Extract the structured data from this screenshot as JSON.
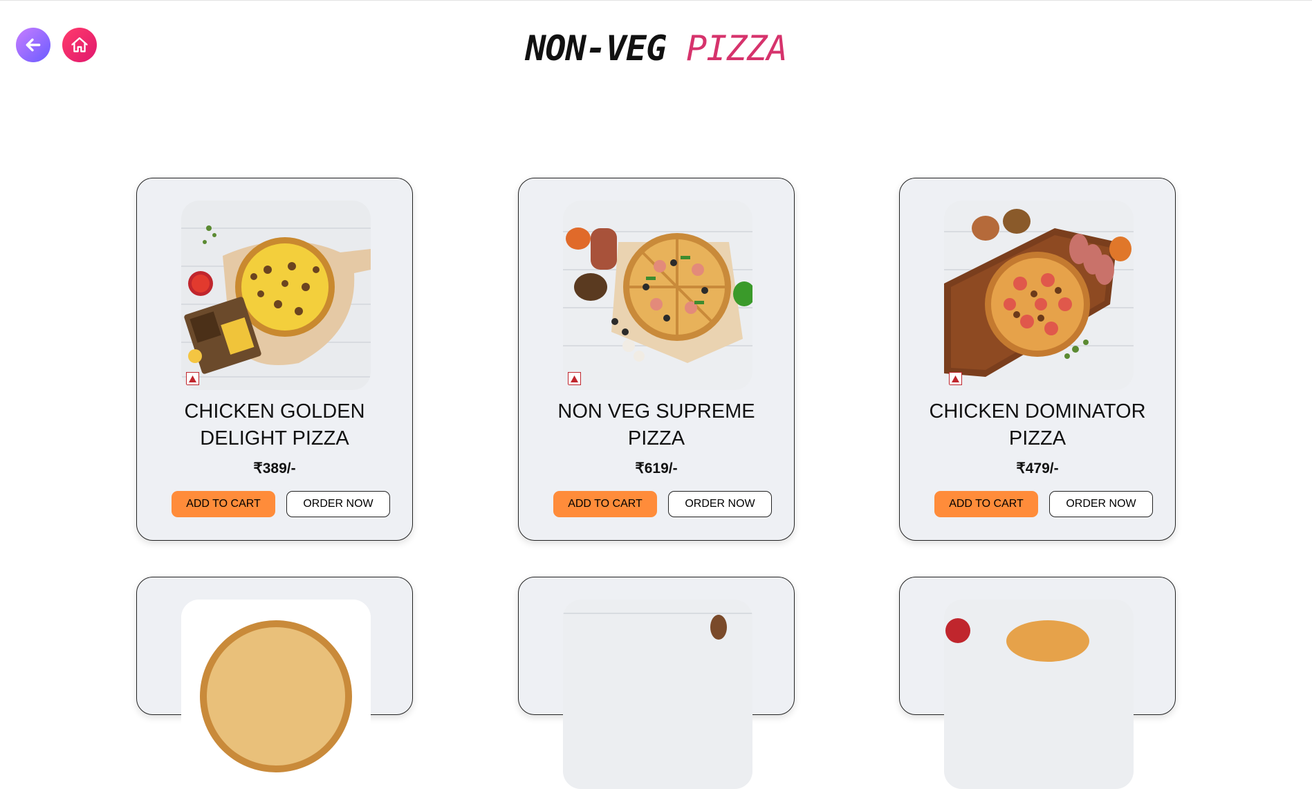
{
  "header": {
    "title_main": "NON-VEG",
    "title_accent": "PIZZA"
  },
  "nav": {
    "back_icon": "arrow-left-icon",
    "home_icon": "home-icon"
  },
  "products": [
    {
      "name": "CHICKEN GOLDEN DELIGHT PIZZA",
      "price": "₹389/-",
      "add_label": "ADD TO CART",
      "order_label": "ORDER NOW"
    },
    {
      "name": "NON VEG SUPREME PIZZA",
      "price": "₹619/-",
      "add_label": "ADD TO CART",
      "order_label": "ORDER NOW"
    },
    {
      "name": "CHICKEN DOMINATOR PIZZA",
      "price": "₹479/-",
      "add_label": "ADD TO CART",
      "order_label": "ORDER NOW"
    }
  ],
  "colors": {
    "accent": "#d6336c",
    "add_button": "#ff8c3a",
    "card_bg": "#eef0f4",
    "nonveg_mark": "#c0262d"
  }
}
